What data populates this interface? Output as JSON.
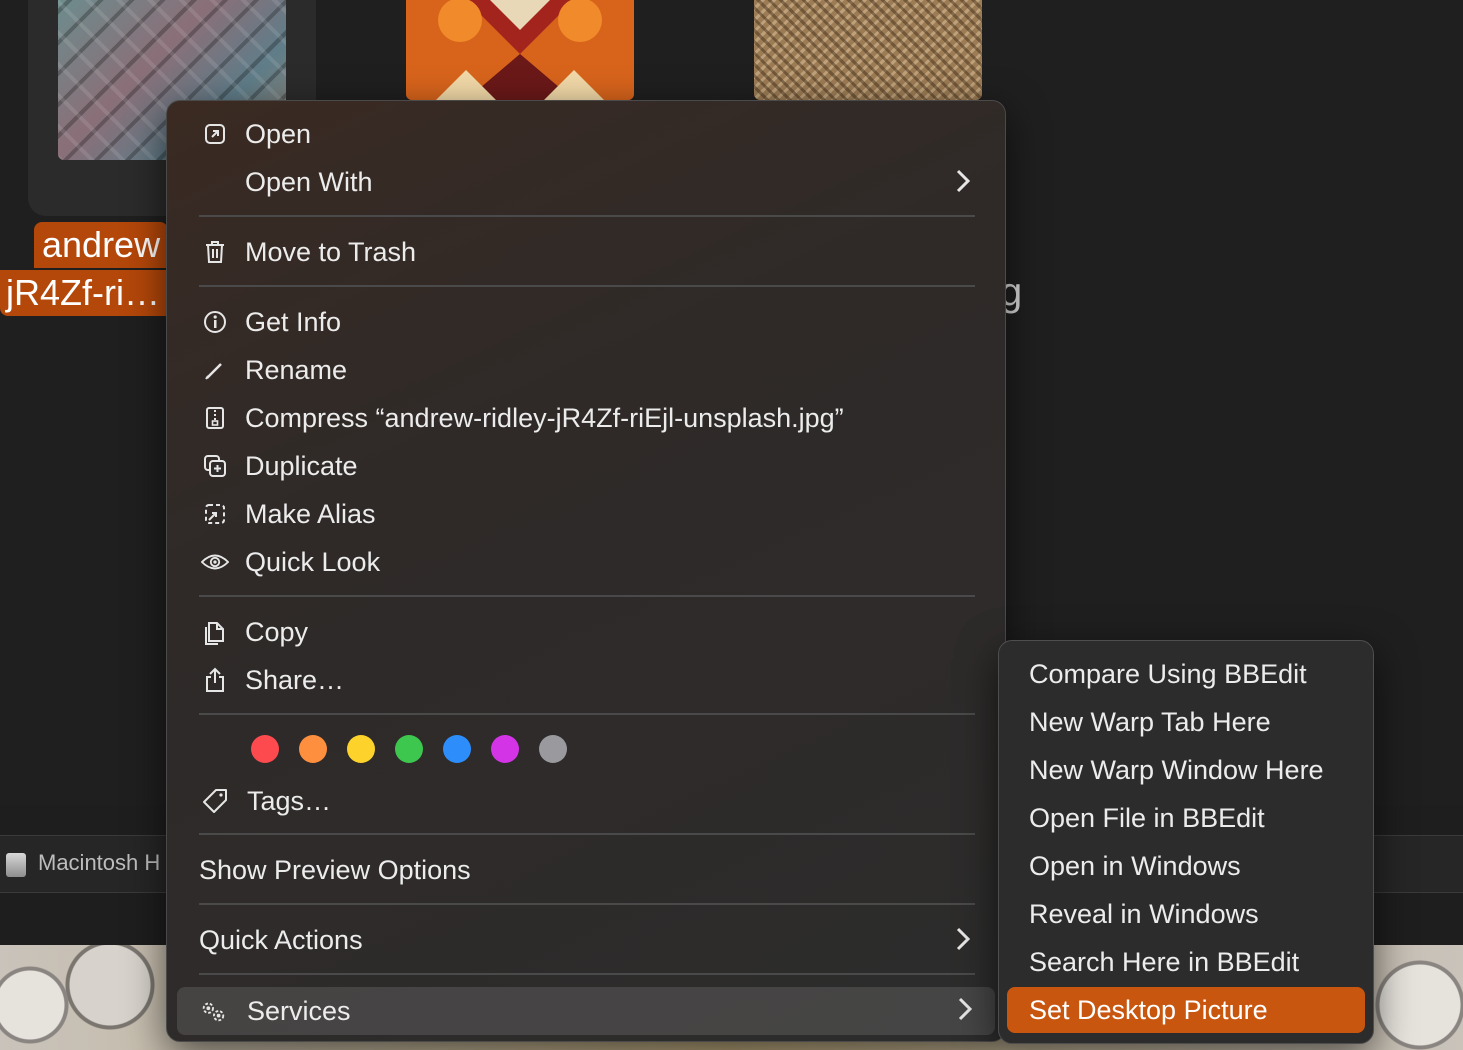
{
  "finder": {
    "selected_filename_line1": "andrew",
    "selected_filename_line2": "jR4Zf-ri…",
    "partial_filename_tail": "g",
    "path_bar_label": "Macintosh H"
  },
  "context_menu": {
    "items": [
      {
        "label": "Open",
        "icon": "open-icon"
      },
      {
        "label": "Open With",
        "has_submenu": true
      },
      {
        "label": "Move to Trash",
        "icon": "trash-icon"
      },
      {
        "label": "Get Info",
        "icon": "info-icon"
      },
      {
        "label": "Rename",
        "icon": "pencil-icon"
      },
      {
        "label": "Compress “andrew-ridley-jR4Zf-riEjl-unsplash.jpg”",
        "icon": "archive-icon"
      },
      {
        "label": "Duplicate",
        "icon": "duplicate-icon"
      },
      {
        "label": "Make Alias",
        "icon": "alias-icon"
      },
      {
        "label": "Quick Look",
        "icon": "eye-icon"
      },
      {
        "label": "Copy",
        "icon": "copy-icon"
      },
      {
        "label": "Share…",
        "icon": "share-icon"
      },
      {
        "label": "Tags…",
        "icon": "tag-icon"
      },
      {
        "label": "Show Preview Options"
      },
      {
        "label": "Quick Actions",
        "has_submenu": true
      },
      {
        "label": "Services",
        "icon": "gears-icon",
        "has_submenu": true,
        "highlighted": true
      }
    ],
    "tag_colors": [
      "#fc4a4f",
      "#fd8f3e",
      "#fdd22b",
      "#3ec74f",
      "#2d8efb",
      "#d234e6",
      "#9a9a9e"
    ]
  },
  "services_submenu": {
    "items": [
      {
        "label": "Compare Using BBEdit"
      },
      {
        "label": "New Warp Tab Here"
      },
      {
        "label": "New Warp Window Here"
      },
      {
        "label": "Open File in BBEdit"
      },
      {
        "label": "Open in Windows"
      },
      {
        "label": "Reveal in Windows"
      },
      {
        "label": "Search Here in BBEdit"
      },
      {
        "label": "Set Desktop Picture",
        "selected": true
      }
    ],
    "selection_color": "#c9560f"
  }
}
